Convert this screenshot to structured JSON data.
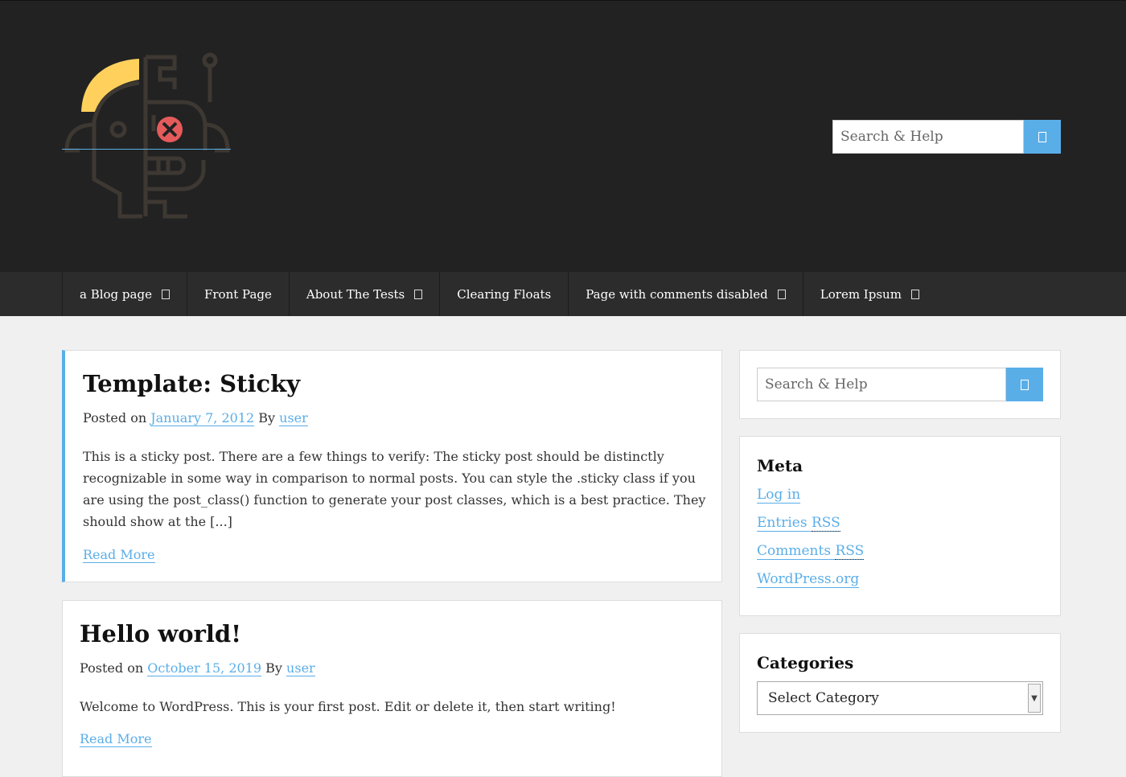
{
  "header": {
    "search_placeholder": "Search & Help",
    "colors": {
      "background": "#222222",
      "accent": "#5aaee8",
      "logo_yellow": "#ffd15c",
      "logo_red": "#e55b5b"
    }
  },
  "nav": {
    "items": [
      {
        "label": "a Blog page",
        "has_submenu": true
      },
      {
        "label": "Front Page",
        "has_submenu": false
      },
      {
        "label": "About The Tests",
        "has_submenu": true
      },
      {
        "label": "Clearing Floats",
        "has_submenu": false
      },
      {
        "label": "Page with comments disabled",
        "has_submenu": true
      },
      {
        "label": "Lorem Ipsum",
        "has_submenu": true
      }
    ]
  },
  "posts": [
    {
      "title": "Template: Sticky",
      "posted_on": "Posted on",
      "date": "January 7, 2012",
      "by": "By",
      "author": "user",
      "excerpt_lines": [
        "This is a sticky post. There are a few things to verify: The sticky post should be distinctly",
        "recognizable in some way in comparison to normal posts. You can style the .sticky class if you",
        "are using the post_class() function to generate your post classes, which is a best practice. They",
        "should show at the [...]"
      ],
      "read_more": "Read More"
    },
    {
      "title": "Hello world!",
      "posted_on": "Posted on",
      "date": "October 15, 2019",
      "by": "By",
      "author": "user",
      "excerpt_lines": [
        "Welcome to WordPress. This is your first post. Edit or delete it, then start writing!"
      ],
      "read_more": "Read More"
    }
  ],
  "sidebar": {
    "search_placeholder": "Search & Help",
    "meta": {
      "title": "Meta",
      "login": "Log in",
      "entries_prefix": "Entries",
      "comments_prefix": "Comments",
      "rss": "RSS",
      "wordpress": "WordPress.org"
    },
    "categories": {
      "title": "Categories",
      "selected": "Select Category"
    }
  }
}
